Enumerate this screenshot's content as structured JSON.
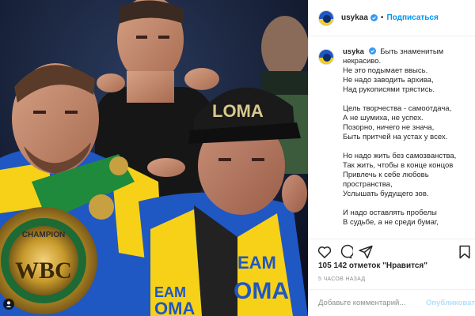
{
  "header": {
    "username": "usykaa",
    "separator": "•",
    "follow_label": "Подписаться"
  },
  "photo": {
    "belt_text_top": "CHAMPION",
    "belt_text_main": "WBC",
    "cap_text": "LOMA",
    "shirt_text_1": "EAM",
    "shirt_text_2": "OMA",
    "shirt_text_3": "EAM",
    "shirt_text_4": "OMA"
  },
  "caption": {
    "username": "usyka",
    "lines": [
      "Быть знаменитым",
      "некрасиво.",
      "Не это подымает ввысь.",
      "Не надо заводить архива,",
      "Над рукописями трястись.",
      "",
      "Цель творчества - самоотдача,",
      "А не шумиха, не успех.",
      "Позорно, ничего не знача,",
      "Быть притчей на устах у всех.",
      "",
      "Но надо жить без самозванства,",
      "Так жить, чтобы в конце концов",
      "Привлечь к себе любовь",
      "пространства,",
      "Услышать будущего зов.",
      "",
      "И надо оставлять пробелы",
      "В судьбе, а не среди бумаг,"
    ]
  },
  "post": {
    "likes": "105 142 отметок \"Нравится\"",
    "time": "5 ЧАСОВ НАЗАД"
  },
  "comment": {
    "placeholder": "Добавьте комментарий...",
    "publish_label": "Опубликовать"
  },
  "colors": {
    "link_blue": "#0095f6",
    "publish_disabled": "#b2dffc",
    "verified_blue": "#3897f0",
    "ukraine_blue": "#1f57c3",
    "ukraine_yellow": "#f7d117"
  }
}
